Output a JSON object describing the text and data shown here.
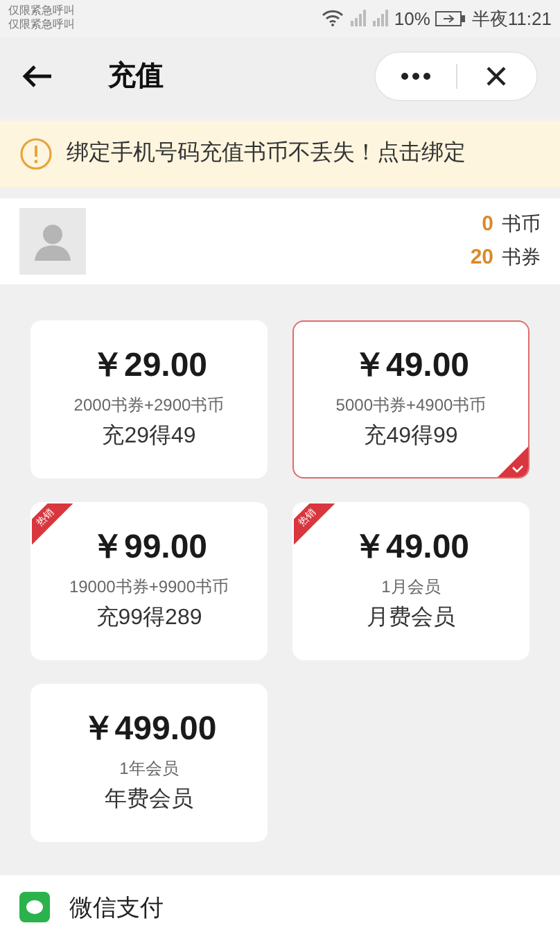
{
  "status_bar": {
    "carrier_lines": [
      "仅限紧急呼叫",
      "仅限紧急呼叫"
    ],
    "battery": "10%",
    "time": "半夜11:21"
  },
  "header": {
    "title": "充值"
  },
  "notice": {
    "text": "绑定手机号码充值书币不丢失！点击绑定"
  },
  "account": {
    "balances": [
      {
        "amount": "0",
        "unit": "书币"
      },
      {
        "amount": "20",
        "unit": "书券"
      }
    ]
  },
  "packages": [
    {
      "price": "￥29.00",
      "detail": "2000书券+2900书币",
      "name": "充29得49",
      "selected": false,
      "hot": false
    },
    {
      "price": "￥49.00",
      "detail": "5000书券+4900书币",
      "name": "充49得99",
      "selected": true,
      "hot": false
    },
    {
      "price": "￥99.00",
      "detail": "19000书券+9900书币",
      "name": "充99得289",
      "selected": false,
      "hot": true,
      "badge": "热销"
    },
    {
      "price": "￥49.00",
      "detail": "1月会员",
      "name": "月费会员",
      "selected": false,
      "hot": true,
      "badge": "热销"
    },
    {
      "price": "￥499.00",
      "detail": "1年会员",
      "name": "年费会员",
      "selected": false,
      "hot": false
    }
  ],
  "payment": {
    "label": "微信支付"
  }
}
